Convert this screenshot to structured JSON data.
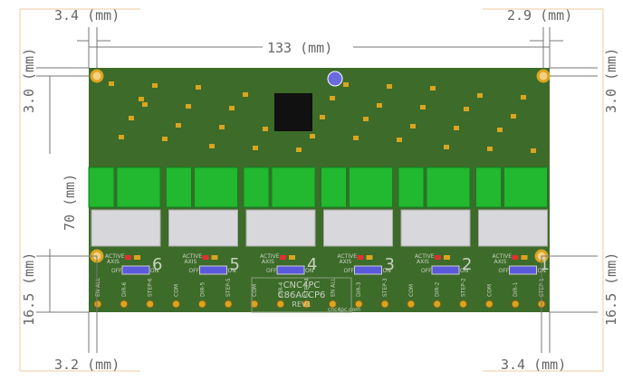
{
  "dimensions": {
    "width": "133 (mm)",
    "height": "70 (mm)",
    "top_left": "3.4 (mm)",
    "top_right": "2.9 (mm)",
    "left_top": "3.0 (mm)",
    "right_top": "3.0 (mm)",
    "left_bottom": "16.5 (mm)",
    "right_bottom": "16.5 (mm)",
    "bottom_left": "3.2 (mm)",
    "bottom_right": "3.4 (mm)"
  },
  "board": {
    "brand": "CNC4PC",
    "model": "C86ACCP6",
    "revision": "REV1",
    "website": "cnc4pc.com",
    "active_label": "ACTIVE",
    "axis_label": "AXIS",
    "off_label": "OFF",
    "on_label": "ON",
    "channels": [
      "6",
      "5",
      "4",
      "3",
      "2",
      "1"
    ],
    "pins": [
      "EN ALL",
      "DIR-6",
      "STEP-6",
      "COM",
      "DIR-5",
      "STEP-5",
      "COM",
      "DIR-4",
      "STEP-4",
      "EN ALL",
      "DIR-3",
      "STEP-3",
      "COM",
      "DIR-2",
      "STEP-2",
      "COM",
      "DIR-1",
      "STEP-1"
    ],
    "colors": {
      "pcb": "#3d6b2a",
      "terminal": "#22b830",
      "connector": "#d8d8dc",
      "gold": "#d9a520",
      "switch": "#5a5adc"
    }
  }
}
